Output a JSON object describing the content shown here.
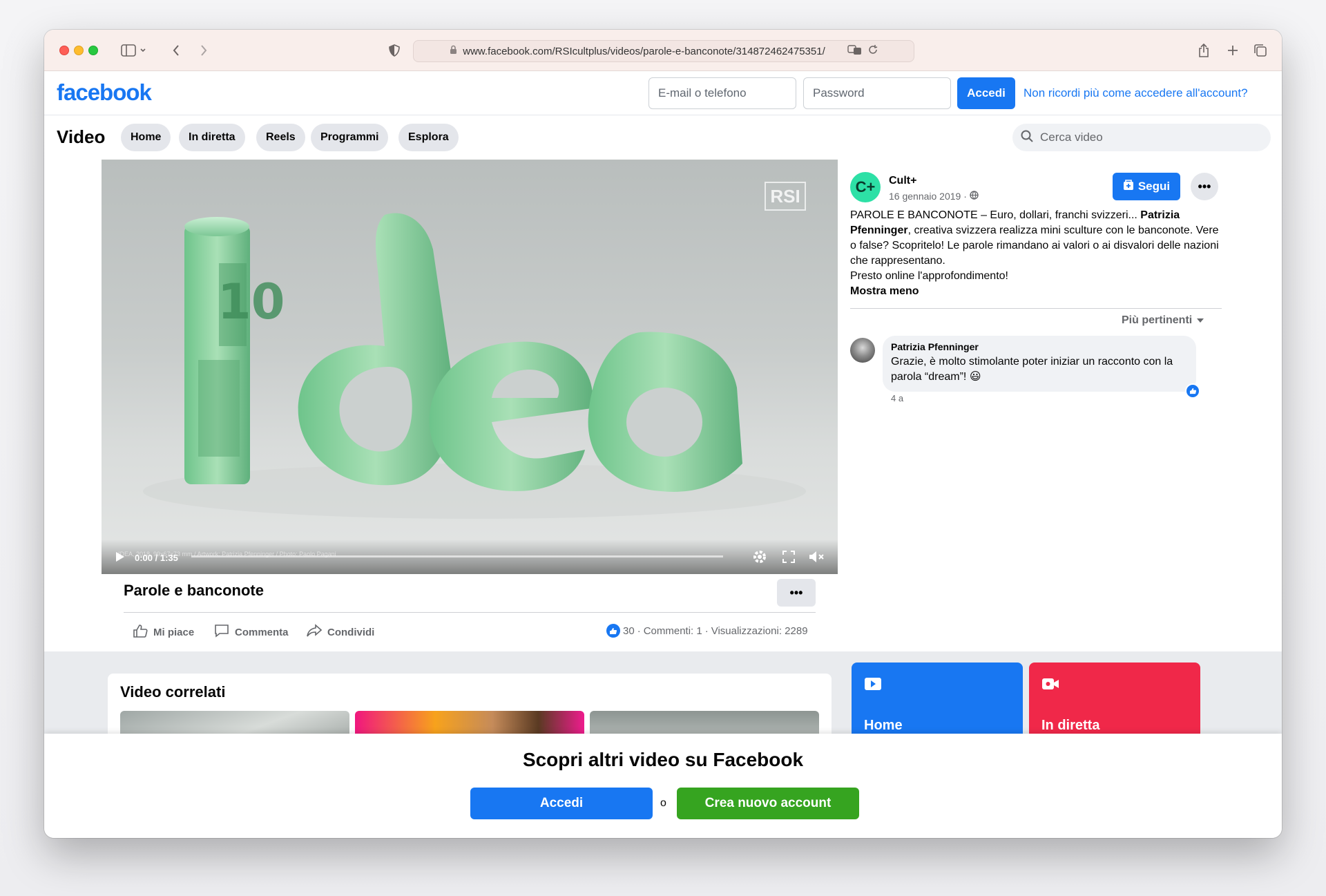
{
  "browser": {
    "url": "www.facebook.com/RSIcultplus/videos/parole-e-banconote/314872462475351/"
  },
  "header": {
    "logo": "facebook",
    "email_placeholder": "E-mail o telefono",
    "password_placeholder": "Password",
    "login_label": "Accedi",
    "forgot_label": "Non ricordi più come accedere all'account?"
  },
  "video_nav": {
    "title": "Video",
    "tabs": [
      {
        "label": "Home"
      },
      {
        "label": "In diretta"
      },
      {
        "label": "Reels"
      },
      {
        "label": "Programmi"
      },
      {
        "label": "Esplora"
      }
    ],
    "search_placeholder": "Cerca video"
  },
  "player": {
    "watermark": "RSI",
    "time": "0:00 / 1:35",
    "caption": "IDEA, 2018, 99x67x73 mm / Artwork: Patrizia Pfenninger / Photo: Paolo Pagani",
    "progress": 0
  },
  "video": {
    "title": "Parole e banconote",
    "more_label": "•••",
    "actions": {
      "like": "Mi piace",
      "comment": "Commenta",
      "share": "Condividi"
    },
    "stats": {
      "likes": "30",
      "comments": "Commenti: 1",
      "views": "Visualizzazioni: 2289",
      "separator": "·"
    }
  },
  "post": {
    "avatar_text": "C+",
    "page_name": "Cult+",
    "date": "16 gennaio 2019 ·",
    "follow_label": "Segui",
    "more_label": "•••",
    "text_1": "PAROLE E BANCONOTE – Euro, dollari, franchi svizzeri... ",
    "text_bold": "Patrizia Pfenninger",
    "text_2": ", creativa svizzera realizza mini sculture con le banconote. Vere o false? Scopritelo! Le parole rimandano ai valori o ai disvalori delle nazioni che rappresentano.",
    "text_3": "Presto online l'approfondimento!",
    "show_less": "Mostra meno"
  },
  "comments": {
    "sort_label": "Più pertinenti",
    "items": [
      {
        "author": "Patrizia Pfenninger",
        "text": "Grazie, è molto stimolante poter iniziar un racconto con la parola “dream”! 😃",
        "time": "4 a"
      }
    ]
  },
  "related": {
    "title": "Video correlati"
  },
  "tiles": [
    {
      "label": "Home",
      "color": "#1877f2"
    },
    {
      "label": "In diretta",
      "color": "#f02849"
    }
  ],
  "overlay": {
    "title": "Scopri altri video su Facebook",
    "login_label": "Accedi",
    "or_label": "o",
    "signup_label": "Crea nuovo account"
  }
}
